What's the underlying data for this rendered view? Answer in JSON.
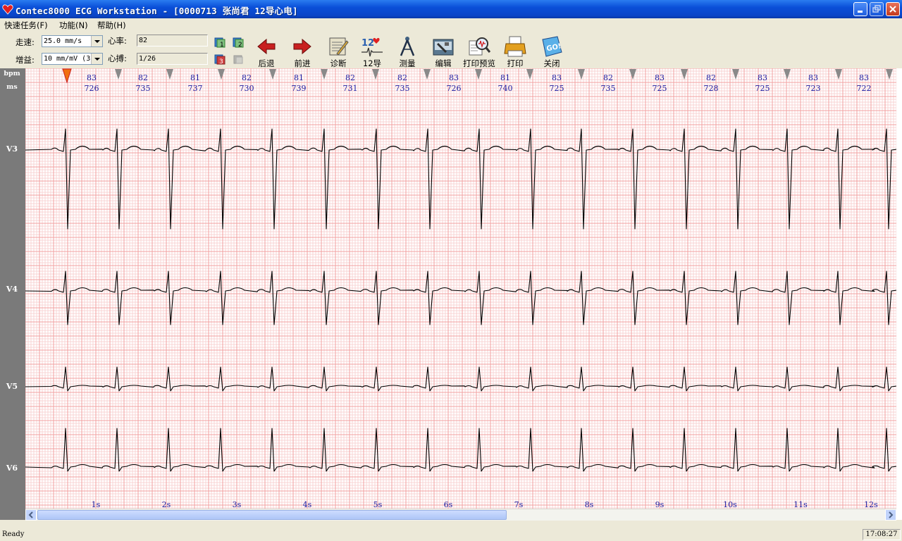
{
  "window": {
    "title": "Contec8000 ECG Workstation - [0000713 张尚君 12导心电]"
  },
  "menu": [
    "快速任务(F)",
    "功能(N)",
    "帮助(H)"
  ],
  "controls": {
    "speed_label": "走速:",
    "speed_value": "25.0 mm/s",
    "gain_label": "增益:",
    "gain_value": "10 mm/mV (3",
    "hr_label": "心率:",
    "hr_value": "82",
    "beat_label": "心搏:",
    "beat_value": "1/26"
  },
  "toolbar": [
    "后退",
    "前进",
    "诊断",
    "12导",
    "测量",
    "编辑",
    "打印预览",
    "打印",
    "关闭"
  ],
  "ecg": {
    "unit_bpm": "bpm",
    "unit_ms": "ms",
    "beats": [
      {
        "bpm": "83",
        "ms": "726"
      },
      {
        "bpm": "82",
        "ms": "735"
      },
      {
        "bpm": "81",
        "ms": "737"
      },
      {
        "bpm": "82",
        "ms": "730"
      },
      {
        "bpm": "81",
        "ms": "739"
      },
      {
        "bpm": "82",
        "ms": "731"
      },
      {
        "bpm": "82",
        "ms": "735"
      },
      {
        "bpm": "83",
        "ms": "726"
      },
      {
        "bpm": "81",
        "ms": "740"
      },
      {
        "bpm": "83",
        "ms": "725"
      },
      {
        "bpm": "82",
        "ms": "735"
      },
      {
        "bpm": "83",
        "ms": "725"
      },
      {
        "bpm": "82",
        "ms": "728"
      },
      {
        "bpm": "83",
        "ms": "725"
      },
      {
        "bpm": "83",
        "ms": "723"
      },
      {
        "bpm": "83",
        "ms": "722"
      }
    ],
    "leads": [
      "V3",
      "V4",
      "V5",
      "V6"
    ],
    "time_ticks": [
      "1s",
      "2s",
      "3s",
      "4s",
      "5s",
      "6s",
      "7s",
      "8s",
      "9s",
      "10s",
      "11s",
      "12s"
    ],
    "grid_color": "#f2a0a0",
    "trace_color": "#000000",
    "label_color": "#1a1aa0"
  },
  "status": {
    "text": "Ready",
    "time": "17:08:27"
  }
}
